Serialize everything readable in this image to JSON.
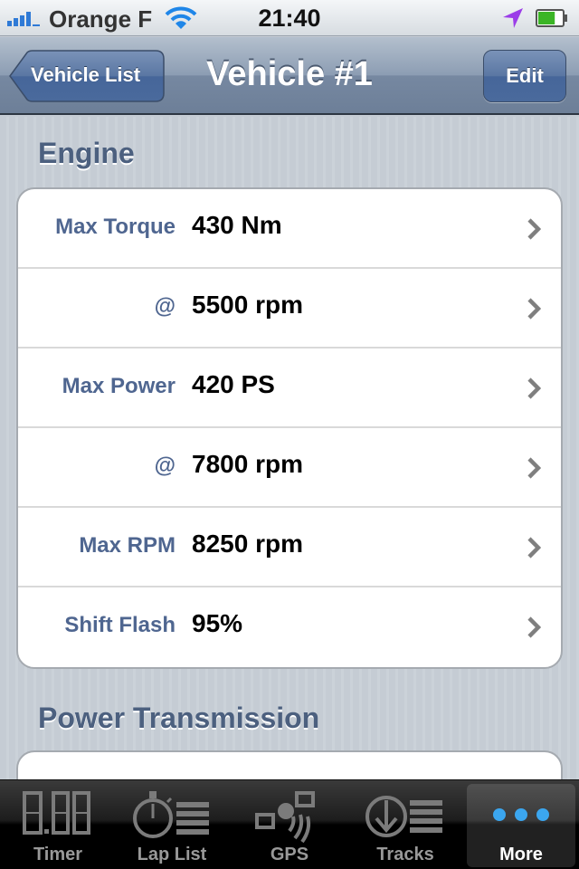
{
  "status_bar": {
    "carrier": "Orange F",
    "time": "21:40",
    "signal_icon": "signal-bars-icon",
    "wifi_icon": "wifi-icon",
    "location_icon": "location-arrow-icon",
    "battery_icon": "battery-icon",
    "battery_level": 0.7
  },
  "nav_bar": {
    "back_label": "Vehicle List",
    "title": "Vehicle #1",
    "edit_label": "Edit"
  },
  "sections": [
    {
      "header": "Engine",
      "rows": [
        {
          "label": "Max Torque",
          "value": "430 Nm"
        },
        {
          "label": "@",
          "value": "5500 rpm"
        },
        {
          "label": "Max Power",
          "value": "420 PS"
        },
        {
          "label": "@",
          "value": "7800 rpm"
        },
        {
          "label": "Max RPM",
          "value": "8250 rpm"
        },
        {
          "label": "Shift Flash",
          "value": "95%"
        }
      ]
    },
    {
      "header": "Power Transmission",
      "rows": []
    }
  ],
  "tab_bar": {
    "tabs": [
      {
        "label": "Timer",
        "icon": "digital-timer-icon"
      },
      {
        "label": "Lap List",
        "icon": "stopwatch-list-icon"
      },
      {
        "label": "GPS",
        "icon": "gps-satellite-icon"
      },
      {
        "label": "Tracks",
        "icon": "download-list-icon"
      },
      {
        "label": "More",
        "icon": "more-dots-icon",
        "active": true
      }
    ]
  },
  "colors": {
    "section_header": "#4c607f",
    "row_label": "#4f6690",
    "nav_bar": "#8c9db3",
    "more_dots": "#3ba6ef"
  }
}
